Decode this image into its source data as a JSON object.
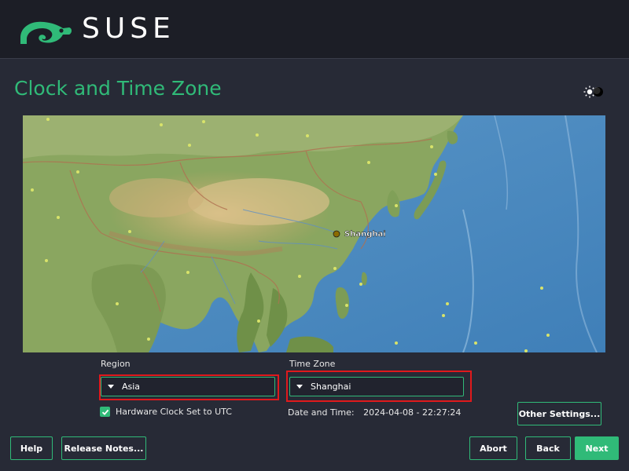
{
  "header": {
    "brand": "SUSE",
    "logo_icon": "chameleon-logo-icon"
  },
  "page": {
    "title": "Clock and Time Zone",
    "theme_toggle_icon": "sun-moon-icon"
  },
  "map": {
    "marker_label": "Shanghai"
  },
  "region": {
    "label": "Region",
    "value": "Asia"
  },
  "timezone": {
    "label": "Time Zone",
    "value": "Shanghai"
  },
  "hardware_clock": {
    "label": "Hardware Clock Set to UTC",
    "checked": true
  },
  "datetime": {
    "label": "Date and Time:",
    "value": "2024-04-08 - 22:27:24"
  },
  "buttons": {
    "other_settings": "Other Settings...",
    "help": "Help",
    "release_notes": "Release Notes...",
    "abort": "Abort",
    "back": "Back",
    "next": "Next"
  },
  "colors": {
    "accent": "#30ba78",
    "highlight": "#e0191c",
    "background": "#272a36"
  }
}
